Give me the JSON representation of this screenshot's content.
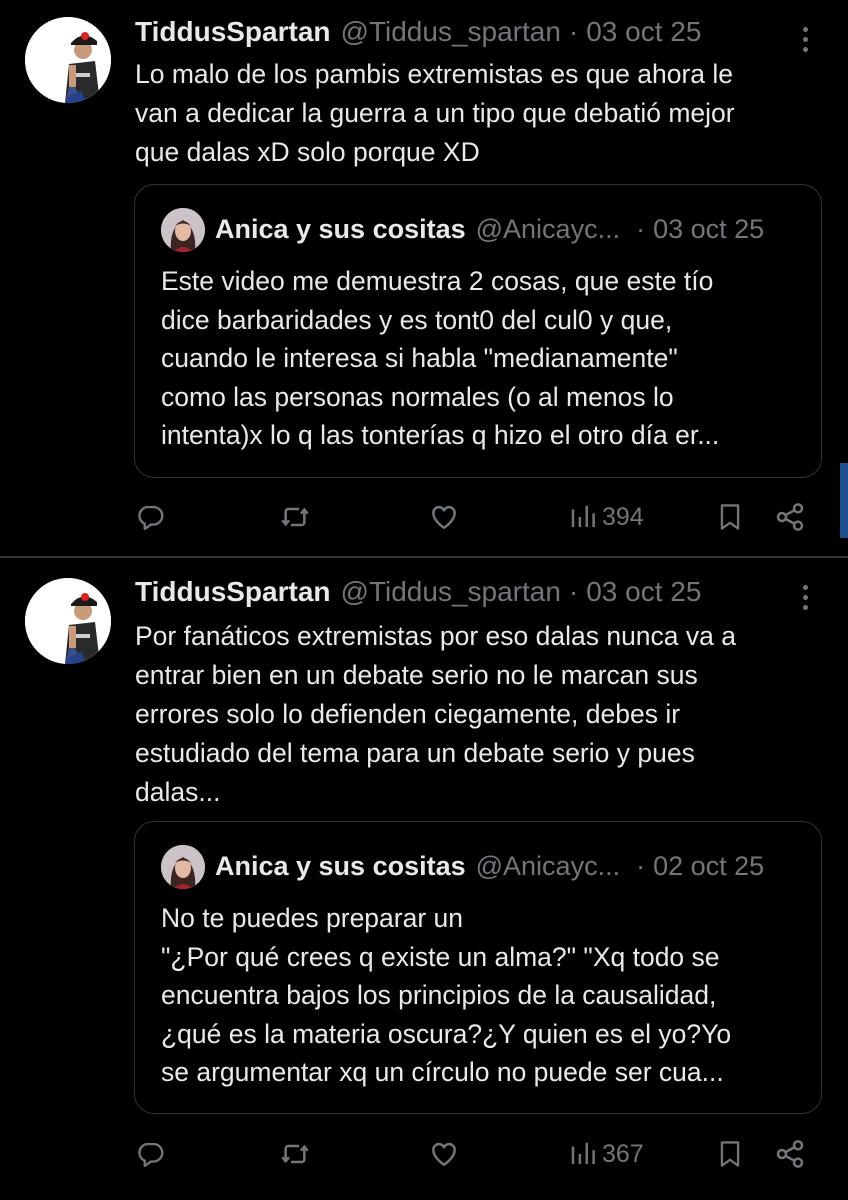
{
  "tweets": [
    {
      "author_name": "TiddusSpartan",
      "author_handle": "@Tiddus_spartan",
      "separator": "·",
      "timestamp": "03 oct 25",
      "text": "Lo malo de los pambis extremistas es que ahora le\nvan a dedicar la guerra a un tipo que debatió mejor\nque dalas xD solo porque XD",
      "quote": {
        "author_name": "Anica y sus cositas",
        "author_handle": "@Anicayc...",
        "separator": "·",
        "timestamp": "03 oct 25",
        "text": "Este video me demuestra 2 cosas, que este tío\ndice barbaridades y es tont0 del cul0 y que,\ncuando le interesa si habla \"medianamente\"\ncomo las personas normales (o al menos lo\nintenta)x lo q las tonterías q hizo el otro día er..."
      },
      "views": "394"
    },
    {
      "author_name": "TiddusSpartan",
      "author_handle": "@Tiddus_spartan",
      "separator": "·",
      "timestamp": "03 oct 25",
      "text": "Por fanáticos extremistas por eso dalas nunca va a\nentrar bien en un debate serio no le marcan sus\nerrores solo lo defienden ciegamente, debes ir\nestudiado del tema para un debate serio y pues\ndalas...",
      "quote": {
        "author_name": "Anica y sus cositas",
        "author_handle": "@Anicayc...",
        "separator": "·",
        "timestamp": "02 oct 25",
        "text": "No te puedes preparar un\n\"¿Por qué crees q existe un alma?\" \"Xq todo se\nencuentra bajos los principios de la causalidad,\n¿qué es la materia oscura?¿Y quien es el yo?Yo\nse argumentar xq un círculo no puede ser cua..."
      },
      "views": "367"
    }
  ],
  "icons": {
    "reply": "reply-icon",
    "repost": "repost-icon",
    "like": "heart-icon",
    "views": "views-chart-icon",
    "bookmark": "bookmark-icon",
    "share": "share-icon",
    "more": "more-vertical-icon"
  },
  "colors": {
    "background": "#000000",
    "text_primary": "#e7e9ea",
    "text_secondary": "#71767b",
    "border": "#2f3336",
    "scroll_indicator": "#1d4f91"
  }
}
